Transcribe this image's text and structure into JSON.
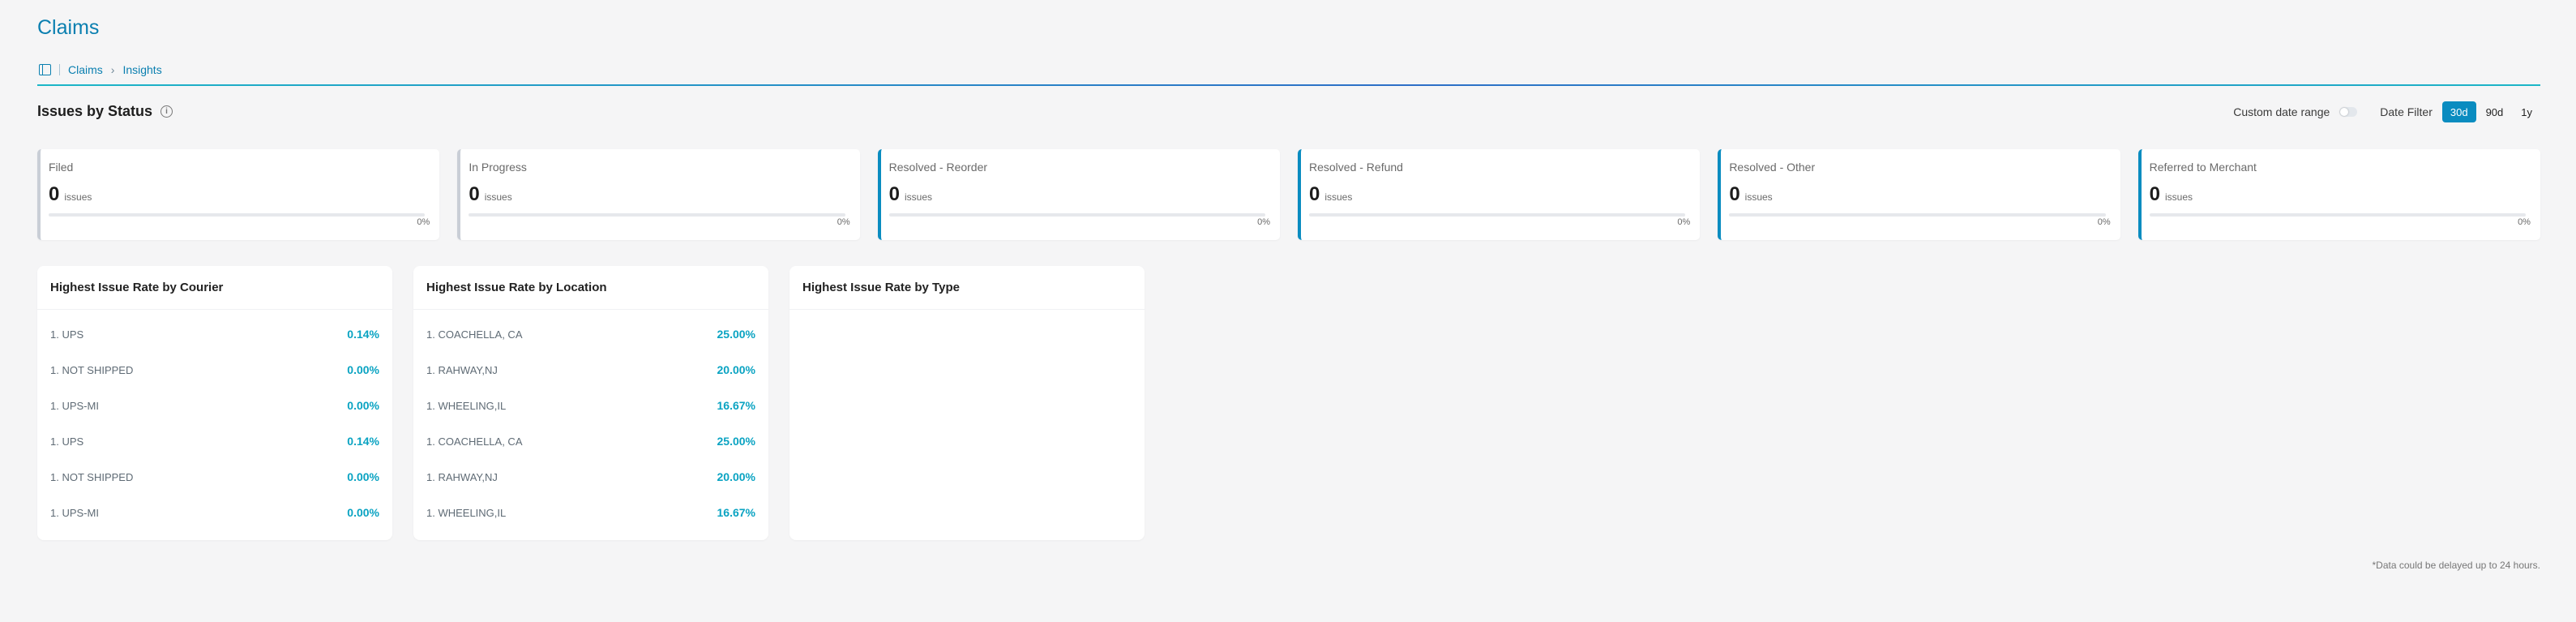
{
  "page": {
    "title": "Claims"
  },
  "breadcrumb": {
    "root": "Claims",
    "current": "Insights"
  },
  "section": {
    "title": "Issues by Status",
    "info_icon": "info-icon"
  },
  "controls": {
    "custom_range_label": "Custom date range",
    "custom_range_on": false,
    "date_filter_label": "Date Filter",
    "ranges": [
      "30d",
      "90d",
      "1y"
    ],
    "selected_range": "30d"
  },
  "colors": {
    "accent": "#0a8cc0",
    "rate_text": "#0aa3c2",
    "title": "#0a7fb0"
  },
  "status_cards": [
    {
      "label": "Filed",
      "value": "0",
      "unit": "issues",
      "pct": "0%",
      "progress": 0,
      "accent": false
    },
    {
      "label": "In Progress",
      "value": "0",
      "unit": "issues",
      "pct": "0%",
      "progress": 0,
      "accent": false
    },
    {
      "label": "Resolved - Reorder",
      "value": "0",
      "unit": "issues",
      "pct": "0%",
      "progress": 0,
      "accent": true
    },
    {
      "label": "Resolved - Refund",
      "value": "0",
      "unit": "issues",
      "pct": "0%",
      "progress": 0,
      "accent": true
    },
    {
      "label": "Resolved - Other",
      "value": "0",
      "unit": "issues",
      "pct": "0%",
      "progress": 0,
      "accent": true
    },
    {
      "label": "Referred to Merchant",
      "value": "0",
      "unit": "issues",
      "pct": "0%",
      "progress": 0,
      "accent": true
    }
  ],
  "rate_cards": [
    {
      "title": "Highest Issue Rate by Courier",
      "items": [
        {
          "name": "1. UPS",
          "rate": "0.14%"
        },
        {
          "name": "1. NOT SHIPPED",
          "rate": "0.00%"
        },
        {
          "name": "1. UPS-MI",
          "rate": "0.00%"
        },
        {
          "name": "1. UPS",
          "rate": "0.14%"
        },
        {
          "name": "1. NOT SHIPPED",
          "rate": "0.00%"
        },
        {
          "name": "1. UPS-MI",
          "rate": "0.00%"
        }
      ]
    },
    {
      "title": "Highest Issue Rate by Location",
      "items": [
        {
          "name": "1. COACHELLA, CA",
          "rate": "25.00%"
        },
        {
          "name": "1. RAHWAY,NJ",
          "rate": "20.00%"
        },
        {
          "name": "1. WHEELING,IL",
          "rate": "16.67%"
        },
        {
          "name": "1. COACHELLA, CA",
          "rate": "25.00%"
        },
        {
          "name": "1. RAHWAY,NJ",
          "rate": "20.00%"
        },
        {
          "name": "1. WHEELING,IL",
          "rate": "16.67%"
        }
      ]
    },
    {
      "title": "Highest Issue Rate by Type",
      "items": []
    }
  ],
  "footnote": "*Data could be delayed up to 24 hours."
}
